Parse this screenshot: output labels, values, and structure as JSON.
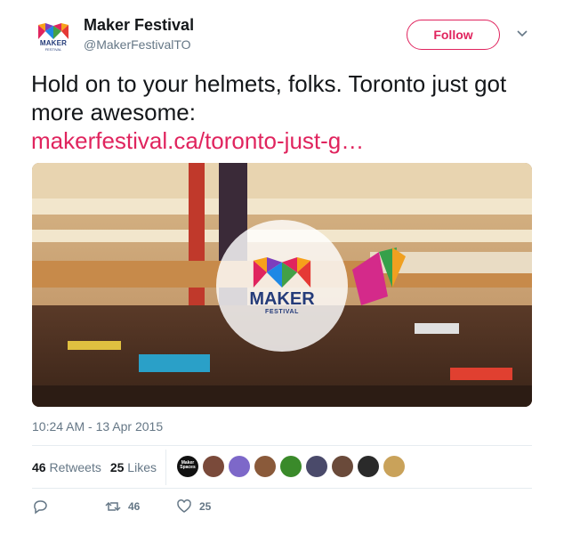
{
  "author": {
    "name": "Maker Festival",
    "handle": "@MakerFestivalTO",
    "avatar_text": "MAKER",
    "avatar_subtext": "FESTIVAL"
  },
  "follow_label": "Follow",
  "tweet": {
    "text": "Hold on to your helmets, folks. Toronto just got more awesome:",
    "link": "makerfestival.ca/toronto-just-g…"
  },
  "media": {
    "logo_text": "MAKER",
    "logo_subtext": "FESTIVAL"
  },
  "timestamp": "10:24 AM - 13 Apr 2015",
  "stats": {
    "retweets_count": "46",
    "retweets_label": "Retweets",
    "likes_count": "25",
    "likes_label": "Likes"
  },
  "likers": [
    {
      "color": "#111111",
      "label": "Maker Spaces"
    },
    {
      "color": "#7a4a3a",
      "label": ""
    },
    {
      "color": "#7d68c9",
      "label": ""
    },
    {
      "color": "#8a5a3a",
      "label": ""
    },
    {
      "color": "#3a8a2a",
      "label": ""
    },
    {
      "color": "#4a4a6a",
      "label": ""
    },
    {
      "color": "#6a4a3a",
      "label": ""
    },
    {
      "color": "#2a2a2a",
      "label": ""
    },
    {
      "color": "#c9a25a",
      "label": ""
    }
  ],
  "actions": {
    "retweet_count": "46",
    "like_count": "25"
  },
  "colors": {
    "accent": "#e0245e",
    "secondary_text": "#657786",
    "brand_navy": "#253c7a"
  }
}
